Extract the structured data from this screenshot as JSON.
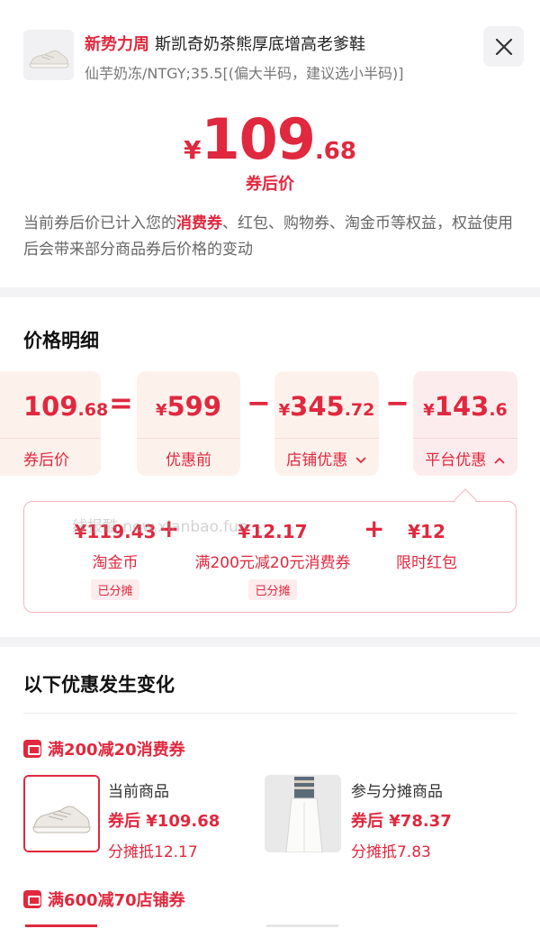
{
  "header": {
    "tag": "新势力周",
    "title": "斯凯奇奶茶熊厚底增高老爹鞋",
    "spec": "仙芋奶冻/NTGY;35.5[(偏大半码，建议选小半码)]",
    "close_icon": "close-icon"
  },
  "price": {
    "currency": "¥",
    "integer": "109",
    "decimal": ".68",
    "label": "券后价"
  },
  "notice": {
    "prefix": "当前券后价已计入您的",
    "highlight": "消费券",
    "suffix": "、红包、购物券、淘金币等权益，权益使用后会带来部分商品券后价格的变动"
  },
  "breakdown": {
    "title": "价格明细",
    "result": {
      "currency": "",
      "integer": "109",
      "decimal": ".68",
      "label": "券后价"
    },
    "eq": "=",
    "original": {
      "currency": "¥",
      "integer": "599",
      "decimal": "",
      "label": "优惠前"
    },
    "minus1": "−",
    "store": {
      "currency": "¥",
      "integer": "345",
      "decimal": ".72",
      "label": "店铺优惠",
      "chevron": "chevron-down-icon"
    },
    "minus2": "−",
    "platform": {
      "currency": "¥",
      "integer": "143",
      "decimal": ".6",
      "label": "平台优惠",
      "chevron": "chevron-up-icon"
    }
  },
  "platform_detail": {
    "items": [
      {
        "amount": "¥119.43",
        "name": "淘金币",
        "tag": "已分摊"
      },
      {
        "amount": "¥12.17",
        "name": "满200元减20元消费券",
        "tag": "已分摊"
      },
      {
        "amount": "¥12",
        "name": "限时红包",
        "tag": ""
      }
    ],
    "plus": "+",
    "watermark": "线报酷 new.xianbao.fun"
  },
  "changes": {
    "title": "以下优惠发生变化",
    "coupons": [
      {
        "name": "满200减20消费券",
        "icon": "coupon-icon",
        "products": [
          {
            "role": "当前商品",
            "price": "券后 ¥109.68",
            "share": "分摊抵12.17"
          },
          {
            "role": "参与分摊商品",
            "price": "券后 ¥78.37",
            "share": "分摊抵7.83"
          }
        ]
      },
      {
        "name": "满600减70店铺券",
        "icon": "shop-coupon-icon"
      }
    ]
  },
  "colors": {
    "accent": "#e0283e",
    "box_bg": "#fdf1ec",
    "pink_bg": "#fdeced"
  }
}
